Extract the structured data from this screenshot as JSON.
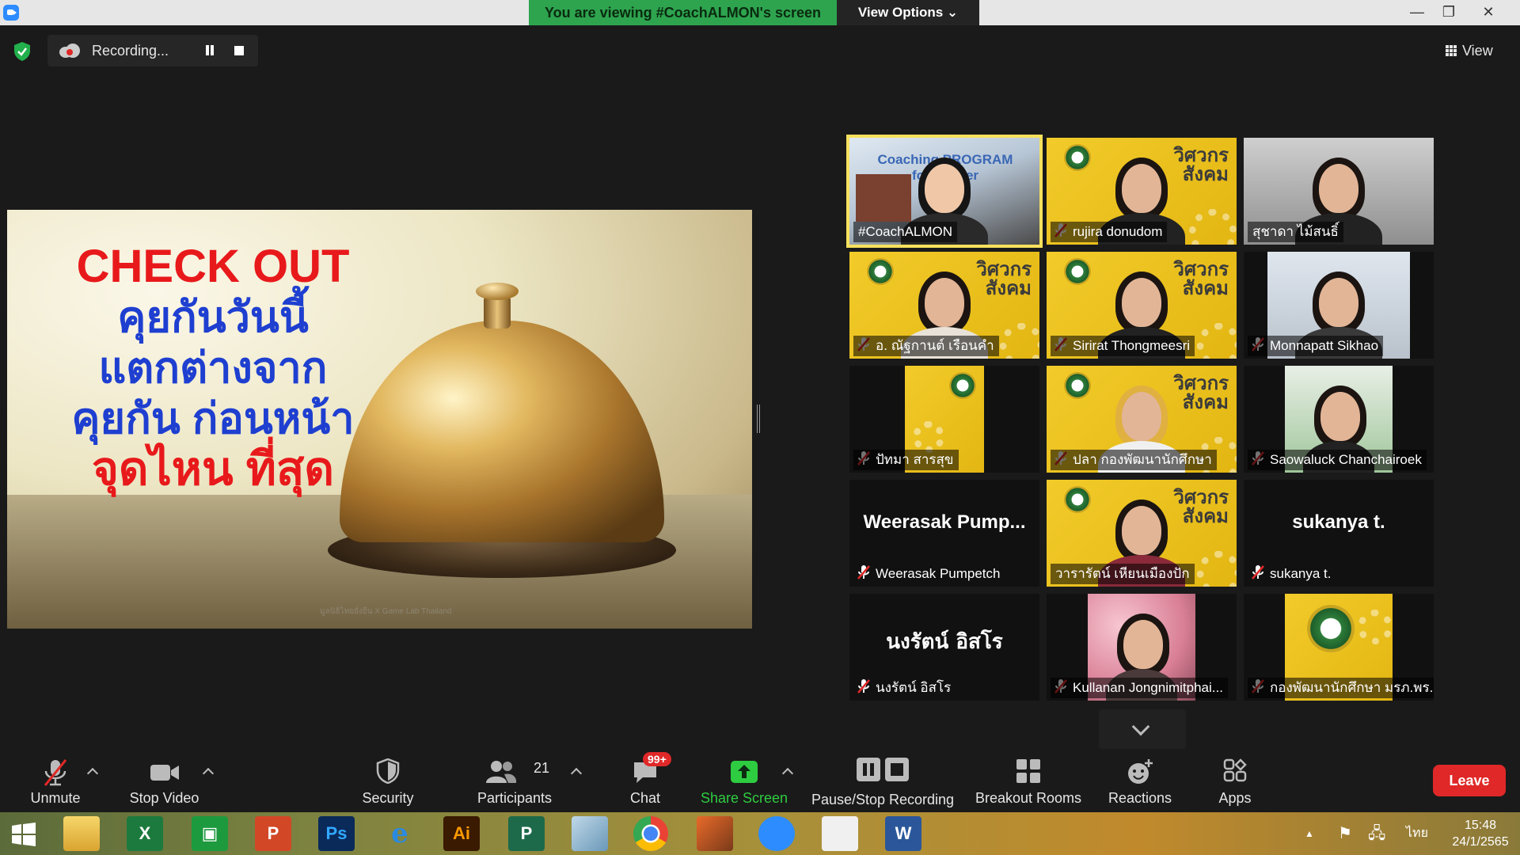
{
  "titlebar": {
    "viewing_banner": "You are viewing #CoachALMON's screen",
    "view_options": "View Options ⌄",
    "minimize": "—",
    "restore": "❐",
    "close": "✕"
  },
  "top": {
    "recording_label": "Recording...",
    "view_label": "View"
  },
  "slide": {
    "line1": "CHECK OUT",
    "line2": "คุยกันวันนี้",
    "line3": "แตกต่างจาก",
    "line4": "คุยกัน ก่อนหน้า",
    "line5": "จุดไหน ที่สุด",
    "credit": "มูลนิธิไทยยั่งยืน X Game Lab Thailand"
  },
  "gallery": {
    "brand_text": "วิศวกรสังคม",
    "active_tile_caption": "Coaching PROGRAM for Trainer",
    "tiles": [
      {
        "name": "#CoachALMON"
      },
      {
        "name": "rujira donudom"
      },
      {
        "name": "สุชาดา ไม้สนธิ์"
      },
      {
        "name": "อ. ณัฐกานต์ เรือนคำ"
      },
      {
        "name": "Sirirat Thongmeesri"
      },
      {
        "name": "Monnapatt Sikhao"
      },
      {
        "name": "ปัทมา สารสุข"
      },
      {
        "name": "ปลา กองพัฒนานักศึกษา"
      },
      {
        "name": "Saowaluck Chanchairoek"
      },
      {
        "name": "Weerasak Pumpetch",
        "big": "Weerasak  Pump..."
      },
      {
        "name": "วารารัตน์ เหียนเมืองปัก"
      },
      {
        "name": "sukanya t.",
        "big": "sukanya t."
      },
      {
        "name": "นงรัตน์ อิสโร",
        "big": "นงรัตน์ อิสโร"
      },
      {
        "name": "Kullanan Jongnimitphai..."
      },
      {
        "name": "กองพัฒนานักศึกษา มรภ.พร..."
      }
    ]
  },
  "toolbar": {
    "unmute": "Unmute",
    "stop_video": "Stop Video",
    "security": "Security",
    "participants": "Participants",
    "participants_count": "21",
    "chat": "Chat",
    "chat_badge": "99+",
    "share_screen": "Share Screen",
    "pause_stop_recording": "Pause/Stop Recording",
    "breakout_rooms": "Breakout Rooms",
    "reactions": "Reactions",
    "apps": "Apps",
    "leave": "Leave"
  },
  "taskbar": {
    "excel": "X",
    "publisher_store": "▣",
    "powerpoint": "P",
    "photoshop": "Ps",
    "ie": "e",
    "illustrator": "Ai",
    "project": "P",
    "word": "W",
    "language": "ไทย",
    "time": "15:48",
    "date": "24/1/2565"
  },
  "colors": {
    "accent_green": "#2ea44f",
    "leave_red": "#e02828",
    "active_speaker": "#f7e15d"
  }
}
